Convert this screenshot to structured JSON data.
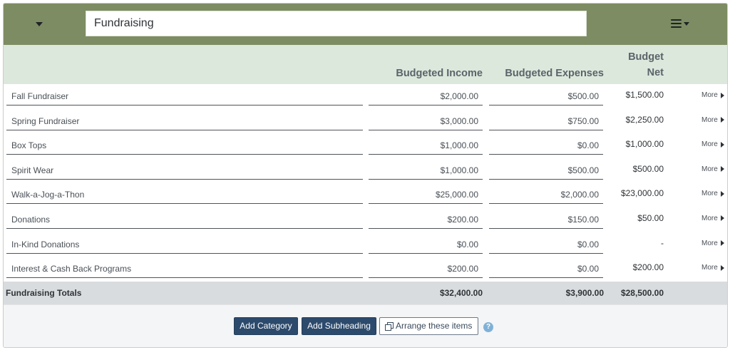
{
  "header": {
    "title_value": "Fundraising",
    "collapse_icon": "caret-down-icon",
    "menu_icon": "hamburger-menu-icon"
  },
  "columns": {
    "income": "Budgeted Income",
    "expenses": "Budgeted Expenses",
    "net": "Budget Net"
  },
  "rows": [
    {
      "name": "Fall Fundraiser",
      "income": "$2,000.00",
      "expenses": "$500.00",
      "net": "$1,500.00",
      "more": "More"
    },
    {
      "name": "Spring Fundraiser",
      "income": "$3,000.00",
      "expenses": "$750.00",
      "net": "$2,250.00",
      "more": "More"
    },
    {
      "name": "Box Tops",
      "income": "$1,000.00",
      "expenses": "$0.00",
      "net": "$1,000.00",
      "more": "More"
    },
    {
      "name": "Spirit Wear",
      "income": "$1,000.00",
      "expenses": "$500.00",
      "net": "$500.00",
      "more": "More"
    },
    {
      "name": "Walk-a-Jog-a-Thon",
      "income": "$25,000.00",
      "expenses": "$2,000.00",
      "net": "$23,000.00",
      "more": "More"
    },
    {
      "name": "Donations",
      "income": "$200.00",
      "expenses": "$150.00",
      "net": "$50.00",
      "more": "More"
    },
    {
      "name": "In-Kind Donations",
      "income": "$0.00",
      "expenses": "$0.00",
      "net": "-",
      "more": "More"
    },
    {
      "name": "Interest & Cash Back Programs",
      "income": "$200.00",
      "expenses": "$0.00",
      "net": "$200.00",
      "more": "More"
    }
  ],
  "totals": {
    "label": "Fundraising Totals",
    "income": "$32,400.00",
    "expenses": "$3,900.00",
    "net": "$28,500.00"
  },
  "footer": {
    "add_category": "Add Category",
    "add_subheading": "Add Subheading",
    "arrange": "Arrange these items",
    "help_glyph": "?"
  },
  "colors": {
    "header_bg": "#7d8c62",
    "column_header_bg": "#dce8dc",
    "totals_bg": "#d9dcdf",
    "primary_button": "#2c4a6c",
    "help_icon": "#7fb1d8"
  }
}
